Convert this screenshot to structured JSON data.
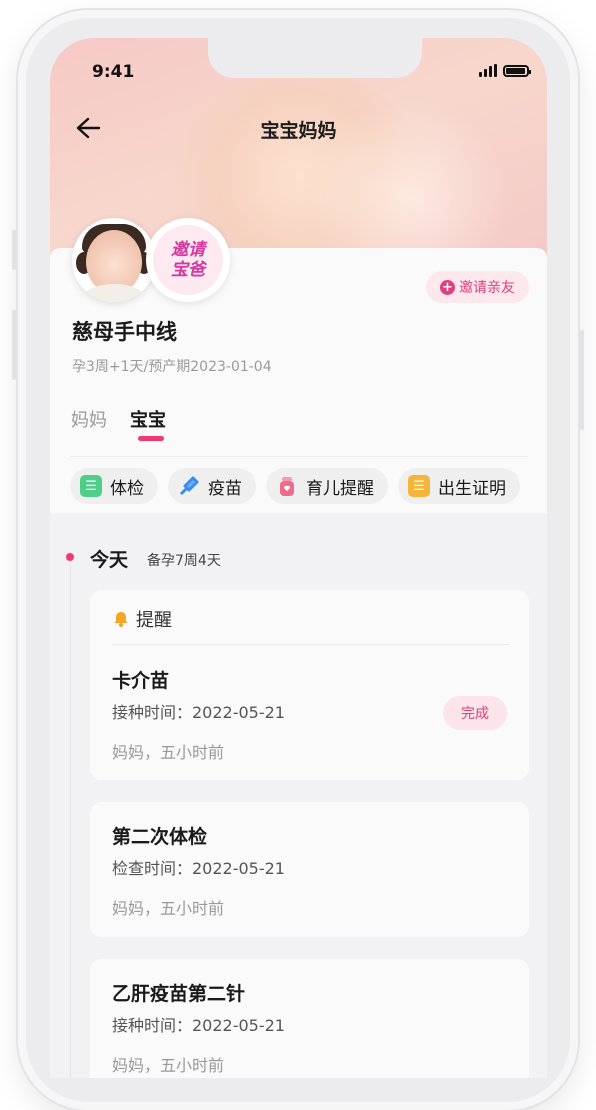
{
  "status_bar": {
    "time": "9:41"
  },
  "header": {
    "title": "宝宝妈妈"
  },
  "profile": {
    "invite_avatar_line1": "邀请",
    "invite_avatar_line2": "宝爸",
    "invite_button": "邀请亲友",
    "name": "慈母手中线",
    "subtitle": "孕3周+1天/预产期2023-01-04"
  },
  "tabs": [
    {
      "label": "妈妈",
      "active": false
    },
    {
      "label": "宝宝",
      "active": true
    }
  ],
  "chips": [
    {
      "label": "体检",
      "icon": "checkup-icon",
      "color": "#4fce8a"
    },
    {
      "label": "疫苗",
      "icon": "vaccine-icon",
      "color": "#3a8cf0"
    },
    {
      "label": "育儿提醒",
      "icon": "bottle-icon",
      "color": "#f06b8c"
    },
    {
      "label": "出生证明",
      "icon": "certificate-icon",
      "color": "#f5b43a"
    }
  ],
  "timeline": {
    "day_label": "今天",
    "day_sub": "备孕7周4天"
  },
  "reminder_section": {
    "label": "提醒"
  },
  "reminders": [
    {
      "title": "卡介苗",
      "meta": "接种时间：2022-05-21",
      "who": "妈妈，五小时前",
      "status": "完成"
    },
    {
      "title": "第二次体检",
      "meta": "检查时间：2022-05-21",
      "who": "妈妈，五小时前"
    },
    {
      "title": "乙肝疫苗第二针",
      "meta": "接种时间：2022-05-21",
      "who": "妈妈，五小时前"
    }
  ]
}
